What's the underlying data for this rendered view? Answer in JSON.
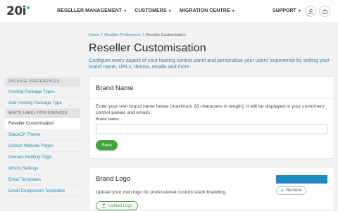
{
  "header": {
    "logo_text": "20i",
    "nav": [
      {
        "label": "RESELLER MANAGEMENT"
      },
      {
        "label": "CUSTOMERS"
      },
      {
        "label": "MIGRATION CENTRE"
      }
    ],
    "support_label": "SUPPORT",
    "icons": [
      "user-icon",
      "basket-icon"
    ]
  },
  "breadcrumb": {
    "items": [
      "Home",
      "Reseller Preferences",
      "Reseller Customisation"
    ],
    "separator": "/"
  },
  "page": {
    "title": "Reseller Customisation",
    "intro": "Configure every aspect of your hosting control panel and personalise your users' experience by setting your brand name, URLs, demos, emails and more."
  },
  "sidebar": {
    "sections": [
      {
        "heading": "PACKAGE PREFERENCES",
        "items": [
          {
            "label": "Hosting Package Types"
          },
          {
            "label": "Add Hosting Package Type"
          }
        ]
      },
      {
        "heading": "WHITE-LABEL PREFERENCES",
        "items": [
          {
            "label": "Reseller Customisation",
            "active": true
          },
          {
            "label": "StackCP Theme"
          },
          {
            "label": "Default Website Pages"
          },
          {
            "label": "Domain Holding Page"
          },
          {
            "label": "WhoIs Settings"
          },
          {
            "label": "Email Templates"
          },
          {
            "label": "Email Component Templates"
          }
        ]
      }
    ]
  },
  "brand_name_card": {
    "title": "Brand Name",
    "description": "Enter your own brand name below (maximum 28 characters in length). It will be displayed in your customers' control panels and emails.",
    "field_label": "Brand Name",
    "field_value": "",
    "save_label": "Save"
  },
  "brand_logo_card": {
    "title": "Brand Logo",
    "description": "Upload your own logo for professional custom stack branding.",
    "upload_label": "Upload Logo",
    "remove_label": "Remove"
  },
  "colors": {
    "accent_blue": "#1d8fc6",
    "save_green": "#42a43d",
    "page_bg": "#f2f2f2"
  }
}
